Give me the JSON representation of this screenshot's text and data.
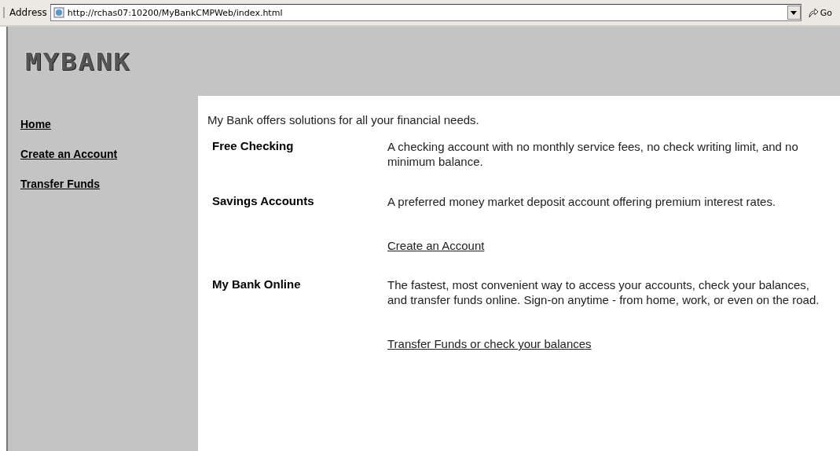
{
  "address_bar": {
    "label": "Address",
    "url": "http://rchas07:10200/MyBankCMPWeb/index.html",
    "go": "Go"
  },
  "logo": "MYBANK",
  "sidebar": {
    "items": [
      {
        "label": "Home"
      },
      {
        "label": "Create an Account"
      },
      {
        "label": "Transfer Funds"
      }
    ]
  },
  "intro": "My Bank offers solutions for all your financial needs.",
  "offers": [
    {
      "title": "Free Checking",
      "description": "A checking account with no monthly service fees, no check writing limit, and no minimum balance."
    },
    {
      "title": "Savings Accounts",
      "description": "A preferred money market deposit account offering premium interest rates.",
      "link": "Create an Account"
    },
    {
      "title": "My Bank Online",
      "description": "The fastest, most convenient way to access your accounts, check your balances, and transfer funds online. Sign-on anytime - from home, work, or even on the road.",
      "link": "Transfer Funds or check your balances"
    }
  ]
}
